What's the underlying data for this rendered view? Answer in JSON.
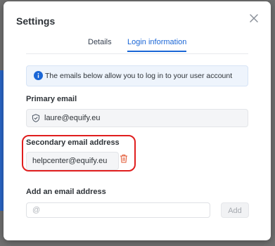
{
  "modal": {
    "title": "Settings"
  },
  "tabs": [
    {
      "label": "Details",
      "active": false
    },
    {
      "label": "Login information",
      "active": true
    }
  ],
  "info": {
    "text": "The emails below allow you to log in to your user account",
    "icon": "info-icon"
  },
  "primary": {
    "label": "Primary email",
    "value": "laure@equify.eu",
    "icon": "shield-icon"
  },
  "secondary": {
    "label": "Secondary email address",
    "value": "helpcenter@equify.eu",
    "delete_icon": "trash-icon"
  },
  "add": {
    "label": "Add an email address",
    "placeholder": "@",
    "button_label": "Add"
  },
  "colors": {
    "accent": "#1a66d6",
    "highlight": "#e01e1e",
    "trash": "#e2542f"
  }
}
